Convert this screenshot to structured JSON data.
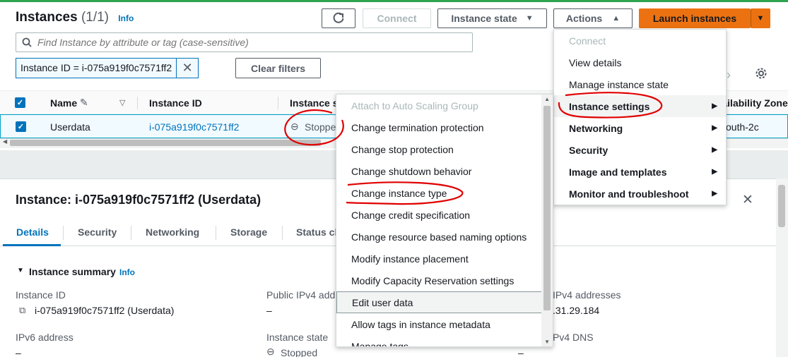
{
  "header": {
    "title": "Instances",
    "count": "(1/1)",
    "info": "Info",
    "connect": "Connect",
    "instance_state": "Instance state",
    "actions": "Actions",
    "launch": "Launch instances"
  },
  "search": {
    "placeholder": "Find Instance by attribute or tag (case-sensitive)"
  },
  "filter": {
    "token": "Instance ID = i-075a919f0c7571ff2",
    "clear": "Clear filters"
  },
  "table": {
    "columns": [
      "Name",
      "Instance ID",
      "Instance s",
      "Availability Zone"
    ],
    "row": {
      "name": "Userdata",
      "id": "i-075a919f0c7571ff2",
      "state": "Stoppe",
      "az": "outh-2c"
    }
  },
  "detail": {
    "title": "Instance: i-075a919f0c7571ff2 (Userdata)",
    "tabs": [
      "Details",
      "Security",
      "Networking",
      "Storage",
      "Status cl"
    ],
    "summary": "Instance summary",
    "info": "Info",
    "fields": {
      "instance_id_label": "Instance ID",
      "instance_id_value": "i-075a919f0c7571ff2 (Userdata)",
      "public_ipv4_label": "Public IPv4 add",
      "public_ipv4_value": "–",
      "private_ipv4_label": "IPv4 addresses",
      "private_ipv4_value": ".31.29.184",
      "ipv6_label": "IPv6 address",
      "ipv6_value": "–",
      "state_label": "Instance state",
      "state_value": "Stopped",
      "dns_label": "Pv4 DNS",
      "dns_value": "–"
    }
  },
  "actions_menu": [
    {
      "label": "Connect",
      "disabled": true
    },
    {
      "label": "View details"
    },
    {
      "label": "Manage instance state"
    },
    {
      "label": "Instance settings",
      "submenu": true
    },
    {
      "label": "Networking",
      "submenu": true
    },
    {
      "label": "Security",
      "submenu": true
    },
    {
      "label": "Image and templates",
      "submenu": true
    },
    {
      "label": "Monitor and troubleshoot",
      "submenu": true
    }
  ],
  "settings_menu": [
    {
      "label": "Attach to Auto Scaling Group",
      "disabled": true
    },
    {
      "label": "Change termination protection"
    },
    {
      "label": "Change stop protection"
    },
    {
      "label": "Change shutdown behavior"
    },
    {
      "label": "Change instance type"
    },
    {
      "label": "Change credit specification"
    },
    {
      "label": "Change resource based naming options"
    },
    {
      "label": "Modify instance placement"
    },
    {
      "label": "Modify Capacity Reservation settings"
    },
    {
      "label": "Edit user data"
    },
    {
      "label": "Allow tags in instance metadata"
    },
    {
      "label": "Manage tags"
    }
  ],
  "colors": {
    "accent": "#0073bb",
    "launch": "#ec7211",
    "annotation": "#e00000"
  }
}
